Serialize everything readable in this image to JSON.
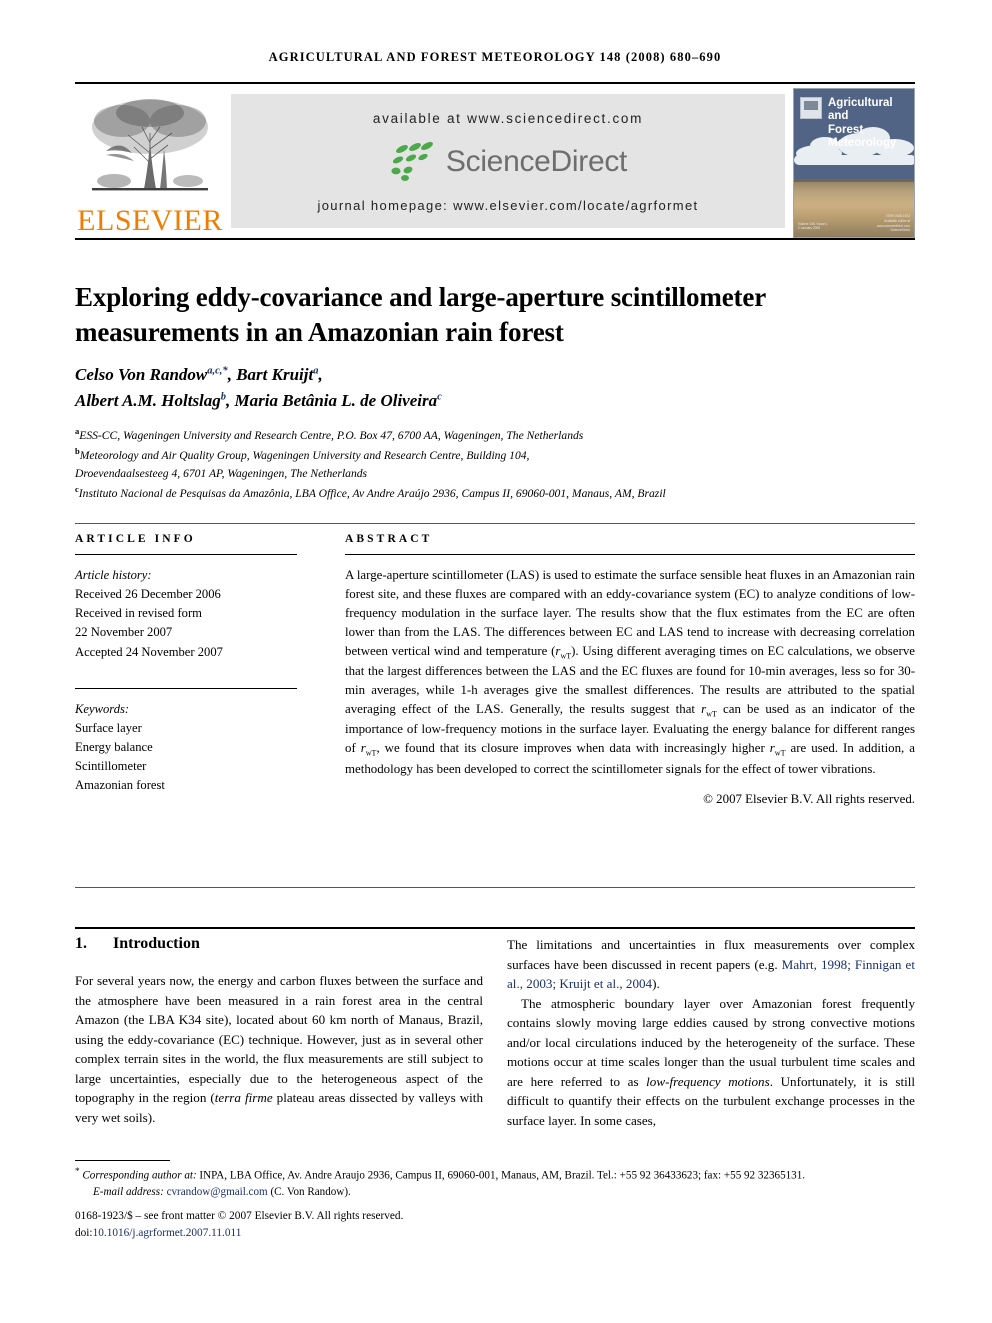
{
  "running_head": "AGRICULTURAL AND FOREST METEOROLOGY 148 (2008) 680–690",
  "masthead": {
    "publisher_name": "ELSEVIER",
    "publisher_logo_icon": "elsevier-tree-icon",
    "available_at": "available at www.sciencedirect.com",
    "sciencedirect_wordmark": "ScienceDirect",
    "sciencedirect_leaf_icon": "sciencedirect-leaves-icon",
    "journal_homepage": "journal homepage: www.elsevier.com/locate/agrformet",
    "cover": {
      "title_line1": "Agricultural",
      "title_line2": "and",
      "title_line3": "Forest Meteorology",
      "publisher_mark_icon": "elsevier-cover-mark-icon",
      "caption_left": "Volume 148 / Issue 1\n2 January 2008",
      "caption_right": "ISSN 0168-1923\nAvailable online at\nwww.sciencedirect.com\nScienceDirect"
    }
  },
  "article": {
    "title": "Exploring eddy-covariance and large-aperture scintillometer measurements in an Amazonian rain forest",
    "authors_line1_name1": "Celso Von Randow",
    "authors_line1_sup1": "a,c,*",
    "authors_line1_name2": "Bart Kruijt",
    "authors_line1_sup2": "a",
    "authors_line2_name1": "Albert A.M. Holtslag",
    "authors_line2_sup1": "b",
    "authors_line2_name2": "Maria Betânia L. de Oliveira",
    "authors_line2_sup2": "c",
    "affiliations": [
      {
        "marker": "a",
        "text": "ESS-CC, Wageningen University and Research Centre, P.O. Box 47, 6700 AA, Wageningen, The Netherlands"
      },
      {
        "marker": "b",
        "text": "Meteorology and Air Quality Group, Wageningen University and Research Centre, Building 104,"
      },
      {
        "marker": "",
        "text": "Droevendaalsesteeg 4, 6701 AP, Wageningen, The Netherlands"
      },
      {
        "marker": "c",
        "text": "Instituto Nacional de Pesquisas da Amazônia, LBA Office, Av Andre Araújo 2936, Campus II, 69060-001, Manaus, AM, Brazil"
      }
    ]
  },
  "article_info": {
    "heading": "ARTICLE INFO",
    "history_label": "Article history:",
    "history": [
      "Received 26 December 2006",
      "Received in revised form",
      "22 November 2007",
      "Accepted 24 November 2007"
    ],
    "keywords_label": "Keywords:",
    "keywords": [
      "Surface layer",
      "Energy balance",
      "Scintillometer",
      "Amazonian forest"
    ]
  },
  "abstract": {
    "heading": "ABSTRACT",
    "part1": "A large-aperture scintillometer (LAS) is used to estimate the surface sensible heat fluxes in an Amazonian rain forest site, and these fluxes are compared with an eddy-covariance system (EC) to analyze conditions of low-frequency modulation in the surface layer. The results show that the flux estimates from the EC are often lower than from the LAS. The differences between EC and LAS tend to increase with decreasing correlation between vertical wind and temperature (",
    "symbol_r": "r",
    "symbol_sub": "wT",
    "part2": "). Using different averaging times on EC calculations, we observe that the largest differences between the LAS and the EC fluxes are found for 10-min averages, less so for 30-min averages, while 1-h averages give the smallest differences. The results are attributed to the spatial averaging effect of the LAS. Generally, the results suggest that ",
    "part3": " can be used as an indicator of the importance of low-frequency motions in the surface layer. Evaluating the energy balance for different ranges of ",
    "part4": ", we found that its closure improves when data with increasingly higher ",
    "part5": " are used. In addition, a methodology has been developed to correct the scintillometer signals for the effect of tower vibrations.",
    "copyright": "© 2007 Elsevier B.V. All rights reserved."
  },
  "body": {
    "section_number": "1.",
    "section_title": "Introduction",
    "left_paragraph_1_a": "For several years now, the energy and carbon fluxes between the surface and the atmosphere have been measured in a rain forest area in the central Amazon (the LBA K34 site), located about 60 km north of Manaus, Brazil, using the eddy-covariance (EC) technique. However, just as in several other complex terrain sites in the world, the flux measurements are still subject to large uncertainties, especially due to the heterogeneous aspect of the topography in the region (",
    "left_paragraph_1_italic": "terra firme",
    "left_paragraph_1_b": " plateau areas dissected by valleys with very wet soils).",
    "right_paragraph_1_a": "The limitations and uncertainties in flux measurements over complex surfaces have been discussed in recent papers (e.g. ",
    "right_paragraph_1_cite": "Mahrt, 1998; Finnigan et al., 2003; Kruijt et al., 2004",
    "right_paragraph_1_b": ").",
    "right_paragraph_2_a": "The atmospheric boundary layer over Amazonian forest frequently contains slowly moving large eddies caused by strong convective motions and/or local circulations induced by the heterogeneity of the surface. These motions occur at time scales longer than the usual turbulent time scales and are here referred to as ",
    "right_paragraph_2_italic": "low-frequency motions",
    "right_paragraph_2_b": ". Unfortunately, it is still difficult to quantify their effects on the turbulent exchange processes in the surface layer. In some cases,"
  },
  "footnotes": {
    "corresponding_marker": "*",
    "corresponding_italic": "Corresponding author at:",
    "corresponding_text": " INPA, LBA Office, Av. Andre Araujo 2936, Campus II, 69060-001, Manaus, AM, Brazil. Tel.: +55 92 36433623; fax: +55 92 32365131.",
    "email_label": "E-mail address:",
    "email_address": "cvrandow@gmail.com",
    "email_owner": "(C. Von Randow).",
    "issn_line": "0168-1923/$ – see front matter © 2007 Elsevier B.V. All rights reserved.",
    "doi_prefix": "doi:",
    "doi_value": "10.1016/j.agrformet.2007.11.011"
  },
  "colors": {
    "elsevier_orange": "#ef7d00",
    "sciencedirect_green": "#4ba94b",
    "sciencedirect_gray": "#6e6e6e",
    "link_blue": "#1a2f6e",
    "banner_gray": "#e4e4e4",
    "cover_sky": "#526486"
  }
}
